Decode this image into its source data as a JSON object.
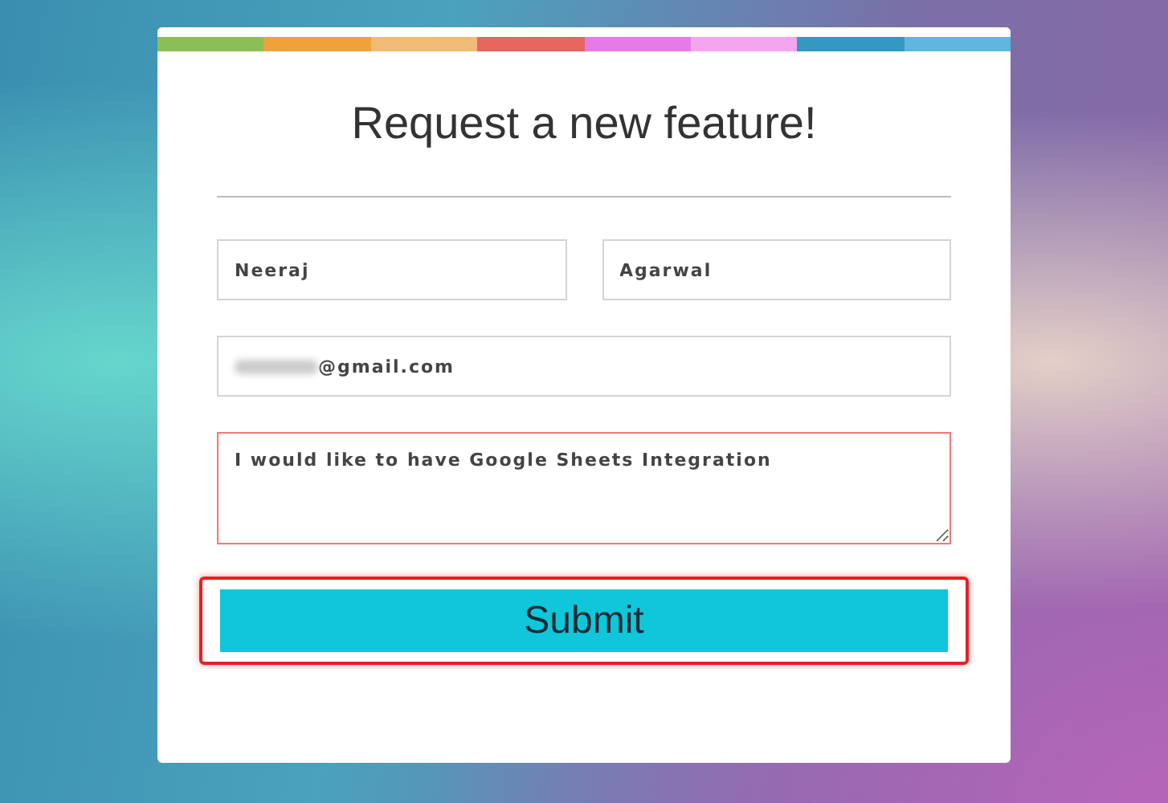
{
  "stripe": [
    {
      "color": "#8bbf56"
    },
    {
      "color": "#f0a23a"
    },
    {
      "color": "#f0bb74"
    },
    {
      "color": "#e8665f"
    },
    {
      "color": "#e87ae8"
    },
    {
      "color": "#f5a5f0"
    },
    {
      "color": "#3398c2"
    },
    {
      "color": "#5db7df"
    }
  ],
  "title": "Request a new feature!",
  "first_name": {
    "value": "Neeraj"
  },
  "last_name": {
    "value": "Agarwal"
  },
  "email": {
    "value": "@gmail.com",
    "redacted_prefix": true
  },
  "message": {
    "value": "I would like to have Google Sheets Integration",
    "invalid": true
  },
  "submit": {
    "label": "Submit",
    "highlighted": true
  }
}
